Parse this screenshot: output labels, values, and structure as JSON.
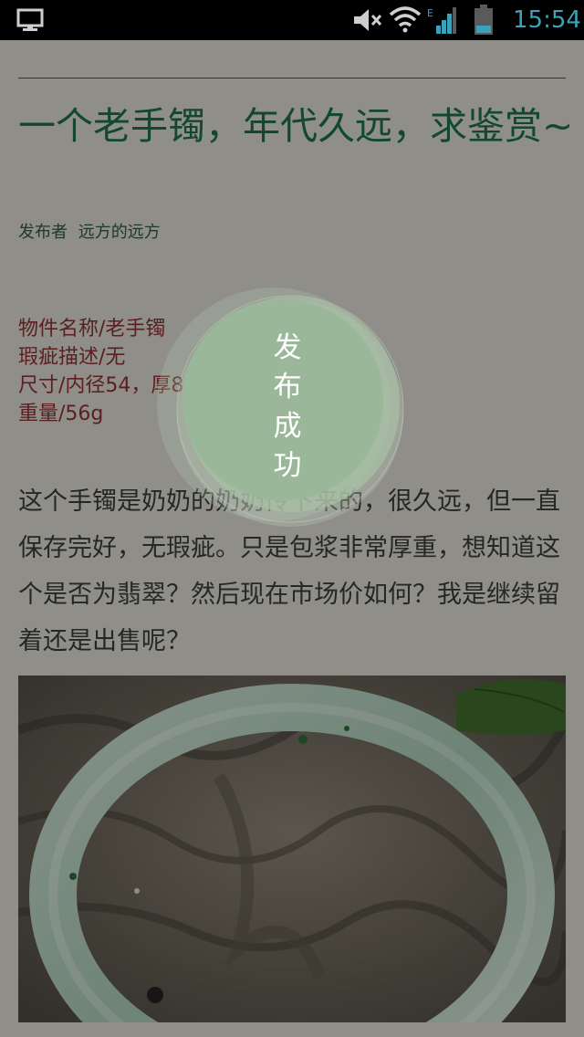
{
  "status_bar": {
    "time": "15:54",
    "icons": [
      "monitor-icon",
      "mute-icon",
      "wifi-icon",
      "signal-icon",
      "battery-icon"
    ],
    "accent_color": "#3aa3b8",
    "network_label": "E"
  },
  "post": {
    "title": "一个老手镯，年代久远，求鉴赏~",
    "author_label": "发布者",
    "author_name": "远方的远方",
    "details": [
      "物件名称/老手镯",
      "瑕疵描述/无",
      "尺寸/内径54，厚8",
      "重量/56g"
    ],
    "body": "这个手镯是奶奶的奶奶传下来的，很久远，但一直保存完好，无瑕疵。只是包浆非常厚重，想知道这个是否为翡翠？然后现在市场价如何？我是继续留着还是出售呢？",
    "photo": "jade-bracelet-photo"
  },
  "toast": {
    "message": "发布成功",
    "color": "#9bb79a"
  }
}
